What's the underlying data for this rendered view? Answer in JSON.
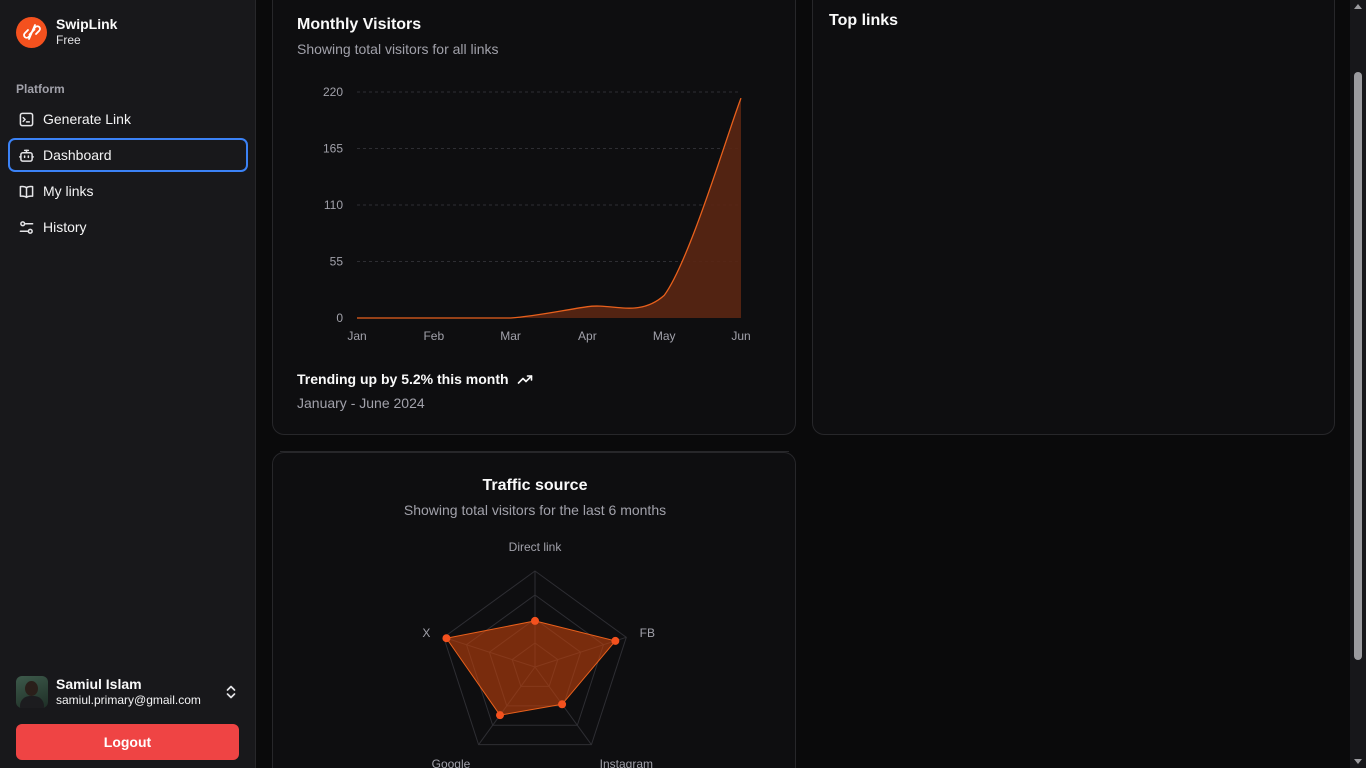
{
  "brand": {
    "name": "SwipLink",
    "plan": "Free"
  },
  "sidebar": {
    "section_label": "Platform",
    "items": [
      {
        "label": "Generate Link",
        "icon": "terminal-icon",
        "active": false
      },
      {
        "label": "Dashboard",
        "icon": "bot-icon",
        "active": true
      },
      {
        "label": "My links",
        "icon": "book-icon",
        "active": false
      },
      {
        "label": "History",
        "icon": "sliders-icon",
        "active": false
      }
    ]
  },
  "user": {
    "name": "Samiul Islam",
    "email": "samiul.primary@gmail.com"
  },
  "logout_label": "Logout",
  "visitors_card": {
    "title": "Monthly Visitors",
    "description": "Showing total visitors for all links",
    "trend": "Trending up by 5.2% this month",
    "range": "January - June 2024"
  },
  "toplinks_card": {
    "title": "Top links"
  },
  "traffic_card": {
    "title": "Traffic source",
    "description": "Showing total visitors for the last 6 months"
  },
  "colors": {
    "accent": "#f4511e",
    "area_stroke": "#e8601c",
    "area_fill": "#5a2613",
    "logout": "#ef4444",
    "active_border": "#3b82f6"
  },
  "chart_data": [
    {
      "type": "area",
      "categories": [
        "Jan",
        "Feb",
        "Mar",
        "Apr",
        "May",
        "Jun"
      ],
      "values": [
        0,
        0,
        0,
        11,
        22,
        214
      ],
      "yticks": [
        0,
        55,
        110,
        165,
        220
      ],
      "ylim": [
        0,
        220
      ],
      "grid": true
    },
    {
      "type": "radar",
      "categories": [
        "Direct link",
        "FB",
        "Instagram",
        "Google",
        "X"
      ],
      "values": [
        0.48,
        0.88,
        0.48,
        0.62,
        0.97
      ],
      "ylim": [
        0,
        1
      ]
    }
  ]
}
